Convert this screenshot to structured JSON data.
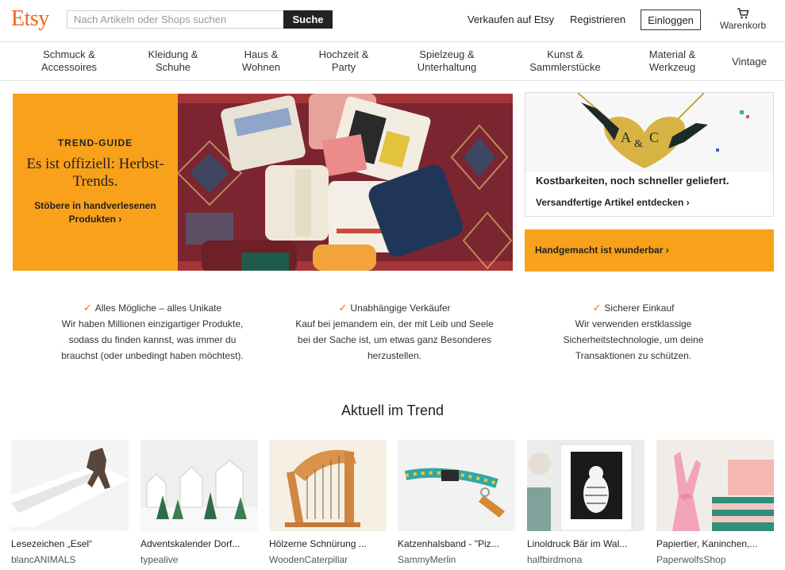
{
  "header": {
    "logo": "Etsy",
    "search_placeholder": "Nach Artikeln oder Shops suchen",
    "search_button": "Suche",
    "sell_link": "Verkaufen auf Etsy",
    "register_link": "Registrieren",
    "login_button": "Einloggen",
    "cart_label": "Warenkorb"
  },
  "categories": [
    "Schmuck &\nAccessoires",
    "Kleidung &\nSchuhe",
    "Haus &\nWohnen",
    "Hochzeit &\nParty",
    "Spielzeug &\nUnterhaltung",
    "Kunst &\nSammlerstücke",
    "Material &\nWerkzeug",
    "Vintage"
  ],
  "hero": {
    "kicker": "TREND-GUIDE",
    "title": "Es ist offiziell: Herbst-Trends.",
    "cta": "Stöbere in handverlesenen Produkten ›"
  },
  "promo": {
    "title": "Kostbarkeiten, noch schneller geliefert.",
    "link": "Versandfertige Artikel entdecken ›"
  },
  "handmade": {
    "label": "Handgemacht ist wunderbar ›"
  },
  "value_props": [
    {
      "heading": "Alles Mögliche – alles Unikate",
      "text": "Wir haben Millionen einzigartiger Produkte, sodass du finden kannst, was immer du brauchst (oder unbedingt haben möchtest)."
    },
    {
      "heading": "Unabhängige Verkäufer",
      "text": "Kauf bei jemandem ein, der mit Leib und Seele bei der Sache ist, um etwas ganz Besonderes herzustellen."
    },
    {
      "heading": "Sicherer Einkauf",
      "text": "Wir verwenden erstklassige Sicherheitstechnologie, um deine Transaktionen zu schützen."
    }
  ],
  "trending": {
    "title": "Aktuell im Trend",
    "items": [
      {
        "title": "Lesezeichen „Esel“",
        "shop": "blancANIMALS"
      },
      {
        "title": "Adventskalender Dorf...",
        "shop": "typealive"
      },
      {
        "title": "Hölzerne Schnürung ...",
        "shop": "WoodenCaterpillar"
      },
      {
        "title": "Katzenhalsband - \"Piz...",
        "shop": "SammyMerlin"
      },
      {
        "title": "Linoldruck Bär im Wal...",
        "shop": "halfbirdmona"
      },
      {
        "title": "Papiertier, Kaninchen,...",
        "shop": "PaperwolfsShop"
      }
    ]
  },
  "colors": {
    "brand": "#f1641e",
    "accent": "#f9a11b"
  }
}
